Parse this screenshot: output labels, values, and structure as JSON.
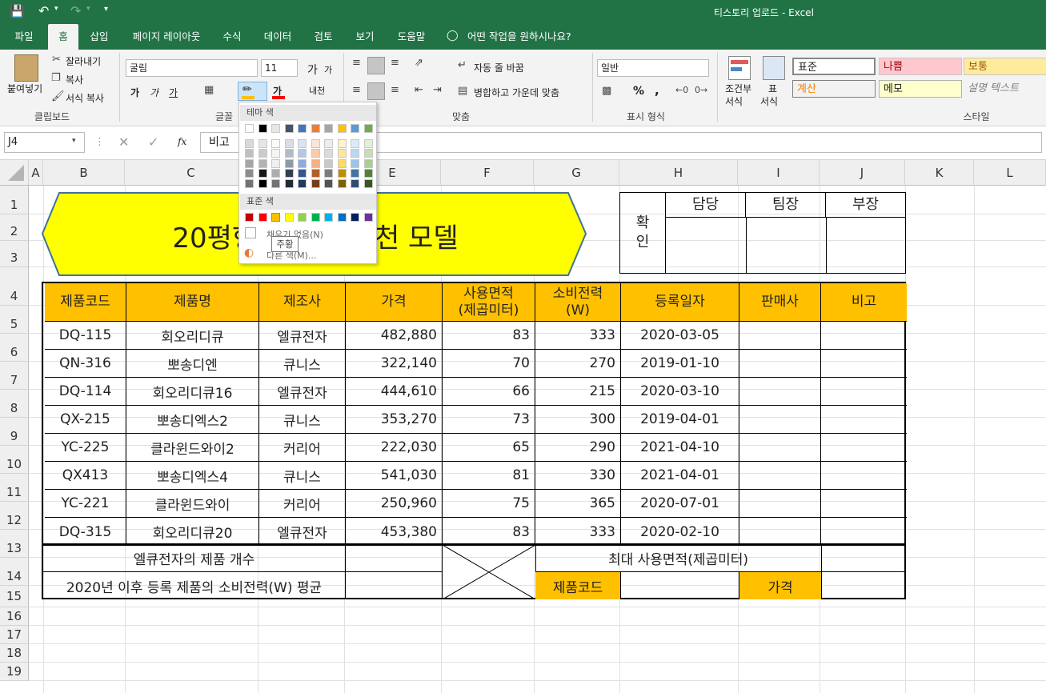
{
  "app": {
    "title": "티스토리 업로드",
    "app_name": "Excel",
    "sep": "-"
  },
  "tabs": [
    "파일",
    "홈",
    "삽입",
    "페이지 레이아웃",
    "수식",
    "데이터",
    "검토",
    "보기",
    "도움말"
  ],
  "tell_me": "어떤 작업을 원하시나요?",
  "ribbon": {
    "clipboard": {
      "paste": "붙여넣기",
      "cut": "잘라내기",
      "copy": "복사",
      "format_painter": "서식 복사",
      "label": "클립보드"
    },
    "font": {
      "name": "굴림",
      "size": "11",
      "label": "글꼴",
      "grow": "가",
      "shrink": "가",
      "bold": "가",
      "italic": "가",
      "underline": "가",
      "font_color": "가",
      "phonetic": "내천"
    },
    "alignment": {
      "wrap": "자동 줄 바꿈",
      "merge": "병합하고 가운데 맞춤",
      "label": "맞춤"
    },
    "number": {
      "format": "일반",
      "label": "표시 형식",
      "percent": "%",
      "comma": ","
    },
    "styles": {
      "cond_1": "조건부",
      "cond_2": "서식",
      "table_1": "표",
      "table_2": "서식",
      "label": "스타일",
      "normal": "표준",
      "bad": "나쁨",
      "good": "보통",
      "calc": "계산",
      "memo": "메모",
      "explain": "설명 텍스트"
    }
  },
  "formula_bar": {
    "name_box": "J4",
    "fx": "fx",
    "value": "비고"
  },
  "palette": {
    "theme_title": "테마 색",
    "standard_title": "표준 색",
    "no_fill": "채우기 없음(N)",
    "more": "다른 색(M)...",
    "tooltip": "주황",
    "theme_top": [
      "#ffffff",
      "#000000",
      "#e7e6e6",
      "#44546a",
      "#4472c4",
      "#ed7d31",
      "#a5a5a5",
      "#ffc000",
      "#5b9bd5",
      "#70ad47"
    ],
    "standard": [
      "#c00000",
      "#ff0000",
      "#ffc000",
      "#ffff00",
      "#92d050",
      "#00b050",
      "#00b0f0",
      "#0070c0",
      "#002060",
      "#7030a0"
    ]
  },
  "columns": [
    "A",
    "B",
    "C",
    "D",
    "E",
    "F",
    "G",
    "H",
    "I",
    "J",
    "K",
    "L"
  ],
  "rows": [
    "1",
    "2",
    "3",
    "4",
    "5",
    "6",
    "7",
    "8",
    "9",
    "10",
    "11",
    "12",
    "13",
    "14",
    "15",
    "16",
    "17",
    "18",
    "19"
  ],
  "sheet": {
    "title": "20평형 에어컨 추천 모델",
    "approval": {
      "confirm": "확\n인",
      "c1": "담당",
      "c2": "팀장",
      "c3": "부장"
    },
    "headers": [
      "제품코드",
      "제품명",
      "제조사",
      "가격",
      "사용면적\n(제곱미터)",
      "소비전력\n(W)",
      "등록일자",
      "판매사",
      "비고"
    ],
    "data": [
      [
        "DQ-115",
        "회오리디큐",
        "엘큐전자",
        "482,880",
        "83",
        "333",
        "2020-03-05"
      ],
      [
        "QN-316",
        "뽀송디엔",
        "큐니스",
        "322,140",
        "70",
        "270",
        "2019-01-10"
      ],
      [
        "DQ-114",
        "회오리디큐16",
        "엘큐전자",
        "444,610",
        "66",
        "215",
        "2020-03-10"
      ],
      [
        "QX-215",
        "뽀송디엑스2",
        "큐니스",
        "353,270",
        "73",
        "300",
        "2019-04-01"
      ],
      [
        "YC-225",
        "클라윈드와이2",
        "커리어",
        "222,030",
        "65",
        "290",
        "2021-04-10"
      ],
      [
        "QX413",
        "뽀송디엑스4",
        "큐니스",
        "541,030",
        "81",
        "330",
        "2021-04-01"
      ],
      [
        "YC-221",
        "클라윈드와이",
        "커리어",
        "250,960",
        "75",
        "365",
        "2020-07-01"
      ],
      [
        "DQ-315",
        "회오리디큐20",
        "엘큐전자",
        "453,380",
        "83",
        "333",
        "2020-02-10"
      ]
    ],
    "summary": {
      "s1": "엘큐전자의 제품 개수",
      "s2": "2020년 이후 등록 제품의 소비전력(W) 평균",
      "s3": "최대 사용면적(제곱미터)",
      "code": "제품코드",
      "price": "가격"
    }
  }
}
